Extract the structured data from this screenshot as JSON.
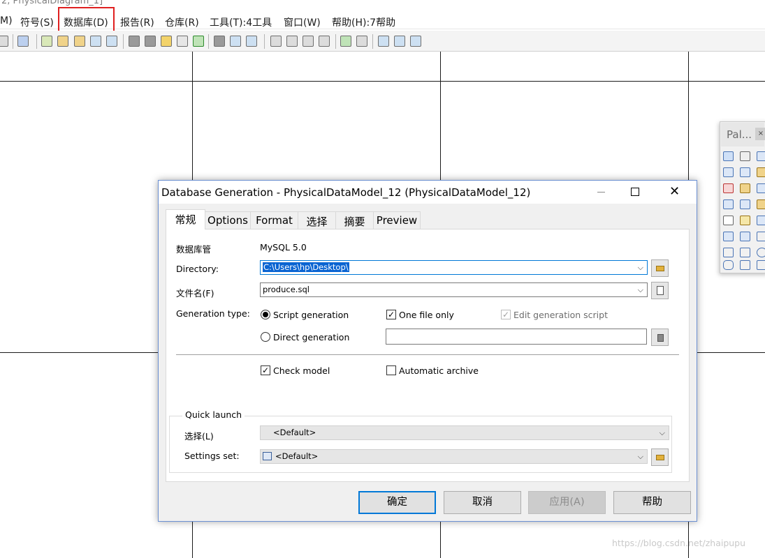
{
  "app": {
    "title_fragment": "2, PhysicalDiagram_1]"
  },
  "menubar": {
    "items": [
      "M)",
      "符号(S)",
      "数据库(D)",
      "报告(R)",
      "仓库(R)",
      "工具(T):4工具",
      "窗口(W)",
      "帮助(H):7帮助"
    ],
    "highlighted": "数据库(D)",
    "highlight_color": "#e02020"
  },
  "toolbar": {
    "icons": [
      "new-icon",
      "help-icon",
      "open-model-icon",
      "save-icon",
      "print-icon",
      "refresh-icon",
      "check-icon",
      "copy-icon",
      "paste-icon",
      "brush-icon",
      "format-icon",
      "font-icon",
      "import-icon",
      "back-icon",
      "forward-icon",
      "view1-icon",
      "view2-icon",
      "view3-icon",
      "view4-icon",
      "model-icon",
      "compare-icon",
      "select-icon",
      "display-icon",
      "table-icon"
    ]
  },
  "palette": {
    "title": "Pal...",
    "close": "×",
    "icons": [
      "pointer-icon",
      "hand-icon",
      "zoom-in-icon",
      "zoom-out-icon",
      "zoom-fit-icon",
      "package-icon",
      "cut-icon",
      "entity-icon",
      "table-icon",
      "db-icon",
      "reference-icon",
      "procedure-icon",
      "note-icon",
      "file-icon",
      "link-icon",
      "sequence-icon",
      "text-icon",
      "line-icon",
      "arc-icon",
      "rectangle-icon",
      "ellipse-icon",
      "rounded-rect-icon",
      "polyline-icon",
      "polygon-icon"
    ]
  },
  "dialog": {
    "title": "Database Generation - PhysicalDataModel_12 (PhysicalDataModel_12)",
    "tabs": [
      "常规",
      "Options",
      "Format",
      "选择",
      "摘要",
      "Preview"
    ],
    "active_tab": "常规",
    "dbms_label": "数据库管",
    "dbms_value": "MySQL 5.0",
    "directory_label": "Directory:",
    "directory_value": "C:\\Users\\hp\\Desktop\\",
    "filename_label": "文件名(F)",
    "filename_value": "produce.sql",
    "gentype_label": "Generation type:",
    "script_generation": "Script generation",
    "direct_generation": "Direct generation",
    "one_file_only": "One file only",
    "edit_generation_script": "Edit generation script",
    "check_model": "Check model",
    "automatic_archive": "Automatic archive",
    "quick_launch": "Quick launch",
    "selection_label": "选择(L)",
    "selection_value": "<Default>",
    "settings_label": "Settings set:",
    "settings_value": "<Default>",
    "buttons": {
      "ok": "确定",
      "cancel": "取消",
      "apply": "应用(A)",
      "help": "帮助"
    },
    "state": {
      "script_generation": true,
      "direct_generation": false,
      "one_file_only": true,
      "edit_generation_script": true,
      "edit_generation_script_enabled": false,
      "check_model": true,
      "automatic_archive": false
    }
  },
  "watermark": "https://blog.csdn.net/zhaipupu"
}
